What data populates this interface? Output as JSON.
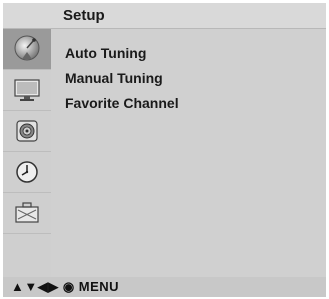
{
  "menu": {
    "title": "Setup",
    "items": [
      {
        "label": "Auto Tuning"
      },
      {
        "label": "Manual Tuning"
      },
      {
        "label": "Favorite Channel"
      }
    ]
  },
  "sidebar": {
    "icons": [
      {
        "name": "satellite-dish-icon",
        "active": true
      },
      {
        "name": "monitor-icon",
        "active": false
      },
      {
        "name": "speaker-icon",
        "active": false
      },
      {
        "name": "clock-icon",
        "active": false
      },
      {
        "name": "toolbox-icon",
        "active": false
      }
    ]
  },
  "footer": {
    "nav_hint": "▲▼◀▶ ◉ MENU"
  },
  "colors": {
    "panel_bg": "#d0d0d0",
    "active_bg": "#9a9a9a",
    "text": "#1a1a1a"
  }
}
